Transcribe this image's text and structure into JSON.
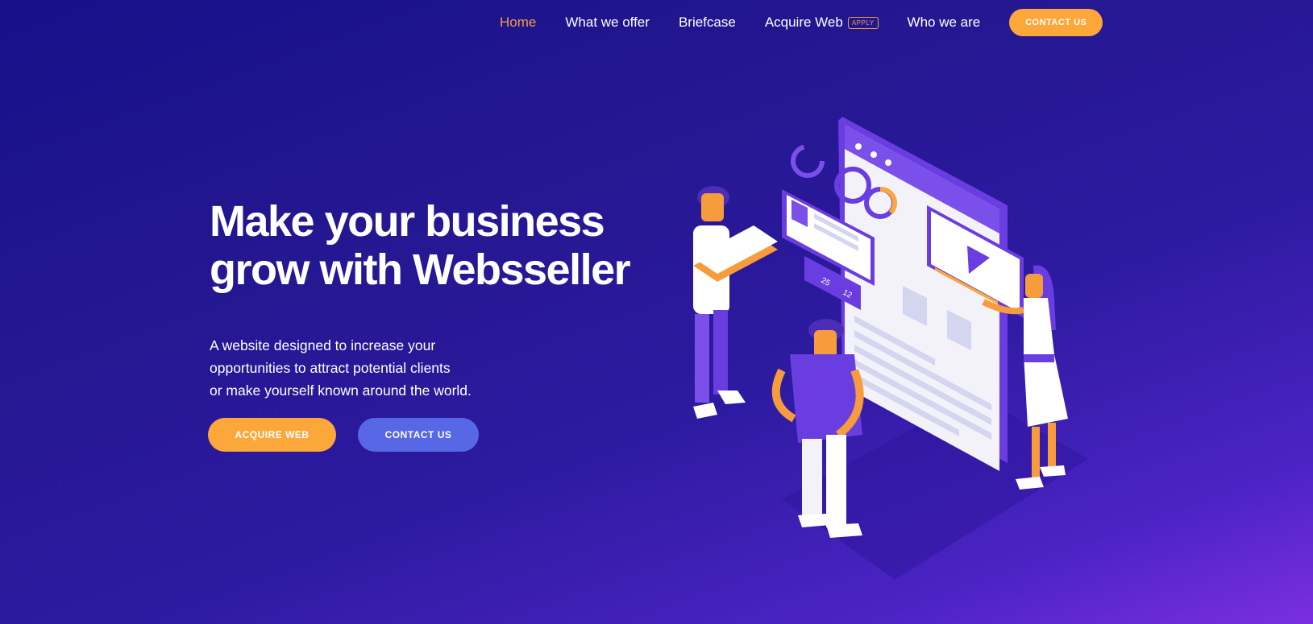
{
  "nav": {
    "items": [
      {
        "label": "Home",
        "active": true
      },
      {
        "label": "What we offer",
        "active": false
      },
      {
        "label": "Briefcase",
        "active": false
      },
      {
        "label": "Acquire Web",
        "active": false,
        "badge": "APPLY"
      },
      {
        "label": "Who we are",
        "active": false
      }
    ],
    "cta_label": "CONTACT US"
  },
  "hero": {
    "title_line1": "Make your business",
    "title_line2": "grow with Websseller",
    "description_line1": "A website designed to increase your",
    "description_line2": "opportunities to attract potential clients",
    "description_line3": "or make yourself known around the world.",
    "primary_button": "ACQUIRE WEB",
    "secondary_button": "CONTACT US"
  },
  "illustration": {
    "likes_count": "25",
    "comments_count": "12"
  },
  "colors": {
    "accent_orange": "#fba73a",
    "accent_blue": "#5767e6",
    "background_dark": "#15108a",
    "background_light": "#7b2fe0",
    "illustration_purple": "#6a3de0"
  }
}
